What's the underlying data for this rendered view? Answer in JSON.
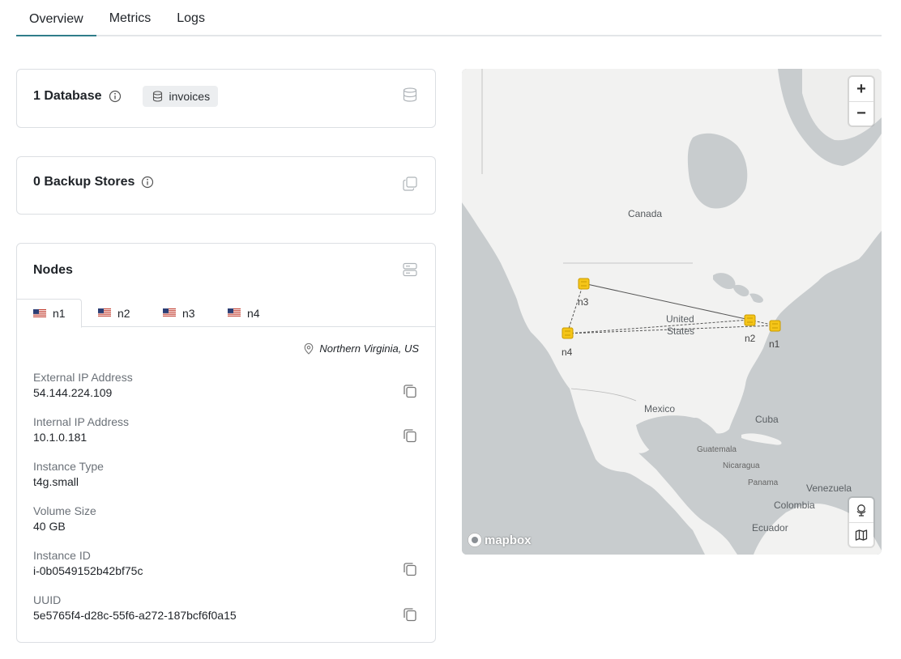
{
  "tabs": [
    {
      "label": "Overview",
      "active": true
    },
    {
      "label": "Metrics",
      "active": false
    },
    {
      "label": "Logs",
      "active": false
    }
  ],
  "databases": {
    "title": "1 Database",
    "chip": "invoices"
  },
  "backups": {
    "title": "0 Backup Stores"
  },
  "nodes": {
    "title": "Nodes",
    "tabs": [
      "n1",
      "n2",
      "n3",
      "n4"
    ],
    "selected": "n1",
    "location": "Northern Virginia, US",
    "fields": [
      {
        "label": "External IP Address",
        "value": "54.144.224.109",
        "copyable": true
      },
      {
        "label": "Internal IP Address",
        "value": "10.1.0.181",
        "copyable": true
      },
      {
        "label": "Instance Type",
        "value": "t4g.small",
        "copyable": false
      },
      {
        "label": "Volume Size",
        "value": "40 GB",
        "copyable": false
      },
      {
        "label": "Instance ID",
        "value": "i-0b0549152b42bf75c",
        "copyable": true
      },
      {
        "label": "UUID",
        "value": "5e5765f4-d28c-55f6-a272-187bcf6f0a15",
        "copyable": true
      }
    ]
  },
  "map": {
    "labels": {
      "canada": "Canada",
      "us_line1": "United",
      "us_line2": "States",
      "mexico": "Mexico",
      "cuba": "Cuba",
      "guatemala": "Guatemala",
      "nicaragua": "Nicaragua",
      "panama": "Panama",
      "venezuela": "Venezuela",
      "colombia": "Colombia",
      "ecuador": "Ecuador"
    },
    "node_labels": {
      "n1": "n1",
      "n2": "n2",
      "n3": "n3",
      "n4": "n4"
    },
    "zoom_in": "+",
    "zoom_out": "−",
    "attribution": "mapbox",
    "land_color": "#f2f2f1",
    "water_color": "#c8ccce",
    "marker_color": "#f5c518"
  },
  "colors": {
    "accent": "#2f7d8a",
    "border": "#dcdfe3",
    "muted_text": "#6b7178"
  }
}
